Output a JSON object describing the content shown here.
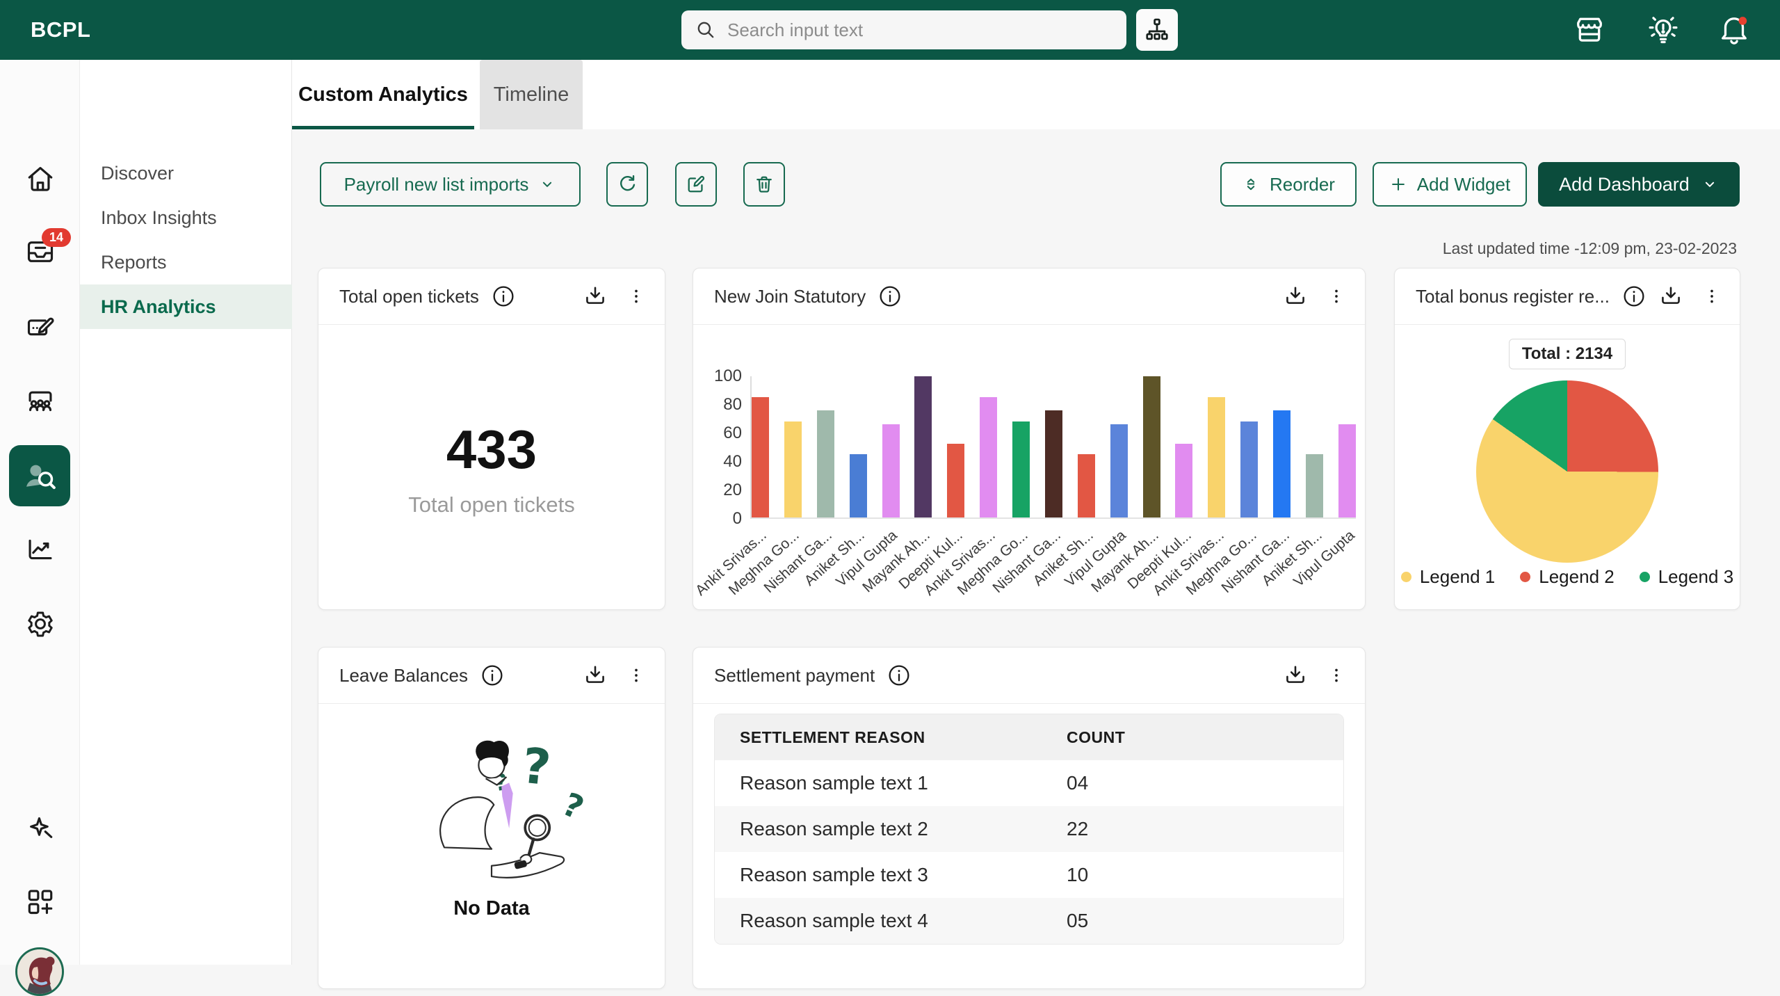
{
  "topbar": {
    "brand": "BCPL",
    "search_placeholder": "Search input text"
  },
  "rail": {
    "inbox_badge": "14",
    "items": [
      "home",
      "inbox",
      "compose",
      "team",
      "people-search",
      "analytics",
      "settings",
      "magic",
      "apps",
      "profile"
    ]
  },
  "sidebar": {
    "items": [
      {
        "label": "Discover",
        "active": false
      },
      {
        "label": "Inbox Insights",
        "active": false
      },
      {
        "label": "Reports",
        "active": false
      },
      {
        "label": "HR Analytics",
        "active": true
      }
    ]
  },
  "tabs": [
    {
      "label": "Custom Analytics",
      "active": true
    },
    {
      "label": "Timeline",
      "active": false
    }
  ],
  "toolbar": {
    "dashboard_dropdown": "Payroll new list imports",
    "reorder_label": "Reorder",
    "add_widget_label": "Add Widget",
    "add_dashboard_label": "Add Dashboard",
    "last_updated": "Last updated time -12:09 pm, 23-02-2023"
  },
  "widgets": {
    "total_open_tickets": {
      "title": "Total open tickets",
      "value": "433",
      "caption": "Total open tickets"
    },
    "new_join_statutory": {
      "title": "New Join Statutory"
    },
    "bonus_register": {
      "title": "Total bonus register re...",
      "total_badge": "Total : 2134"
    },
    "leave_balances": {
      "title": "Leave Balances",
      "empty_text": "No Data"
    },
    "settlement_payment": {
      "title": "Settlement payment",
      "table": {
        "headers": [
          "SETTLEMENT REASON",
          "COUNT"
        ],
        "rows": [
          [
            "Reason sample text 1",
            "04"
          ],
          [
            "Reason sample text 2",
            "22"
          ],
          [
            "Reason sample text 3",
            "10"
          ],
          [
            "Reason sample text 4",
            "05"
          ]
        ]
      }
    }
  },
  "chart_data": [
    {
      "id": "new-join-statutory",
      "type": "bar",
      "title": "New Join Statutory",
      "categories": [
        "Ankit Srivas...",
        "Meghna Go...",
        "Nishant Ga...",
        "Aniket Sh...",
        "Vipul Gupta",
        "Mayank Ah...",
        "Deepti Kul...",
        "Ankit Srivas...",
        "Meghna Go...",
        "Nishant Ga...",
        "Aniket Sh...",
        "Vipul Gupta",
        "Mayank Ah...",
        "Deepti Kul...",
        "Ankit Srivas...",
        "Meghna Go...",
        "Nishant Ga...",
        "Aniket Sh...",
        "Vipul Gupta"
      ],
      "values": [
        85,
        68,
        76,
        45,
        66,
        100,
        52,
        85,
        68,
        76,
        45,
        66,
        100,
        52,
        85,
        68,
        76,
        45,
        66
      ],
      "bar_colors": [
        "#E25744",
        "#F9D36B",
        "#9FB9AB",
        "#4A7DD4",
        "#E18CF0",
        "#523863",
        "#E25744",
        "#E18CF0",
        "#17A364",
        "#4D2C25",
        "#E25744",
        "#5B84DA",
        "#5E5428",
        "#E18CF0",
        "#F9D36B",
        "#5B84DA",
        "#2478F2",
        "#9FB9AB",
        "#E18CF0"
      ],
      "ylim": [
        0,
        100
      ],
      "yticks": [
        0,
        20,
        40,
        60,
        80,
        100
      ],
      "x_label_rotation_deg": -42,
      "grid": false,
      "legend": "none"
    },
    {
      "id": "total-bonus-register",
      "type": "pie",
      "title": "Total bonus register re...",
      "labels": [
        "Legend 1",
        "Legend 2",
        "Legend 3"
      ],
      "values_pct": [
        59.7,
        19.5,
        20.8
      ],
      "colors": [
        "#F9D36B",
        "#E25744",
        "#17A364"
      ],
      "start_angle_deg": 20,
      "draw_order": [
        1,
        0,
        2
      ],
      "total_label": "Total : 2134",
      "legend_position": "bottom"
    }
  ],
  "colors": {
    "brand_green": "#0B5745",
    "outline_button_green": "#176A50",
    "primary_button_green": "#0B4C3C",
    "badge_red": "#E23A30",
    "active_row_bg": "#E8F0EB"
  },
  "icons": {
    "search-icon": "magnifier",
    "org-chart-icon": "sitemap",
    "store-icon": "storefront",
    "ideas-icon": "lightbulb",
    "notifications-icon": "bell-with-dot",
    "home-icon": "house",
    "inbox-icon": "inbox-tray",
    "compose-icon": "card-pencil",
    "team-icon": "people-group",
    "people-search-icon": "person-magnifier",
    "analytics-icon": "line-chart",
    "settings-icon": "gear",
    "magic-icon": "sparkle",
    "apps-icon": "grid-plus",
    "refresh-icon": "circular-arrow",
    "edit-icon": "pencil-square",
    "delete-icon": "trash",
    "reorder-icon": "up-down-chevrons",
    "add-icon": "plus",
    "chevron-down-icon": "caret",
    "info-icon": "i-circle",
    "download-icon": "arrow-into-tray",
    "kebab-icon": "three-dots"
  }
}
